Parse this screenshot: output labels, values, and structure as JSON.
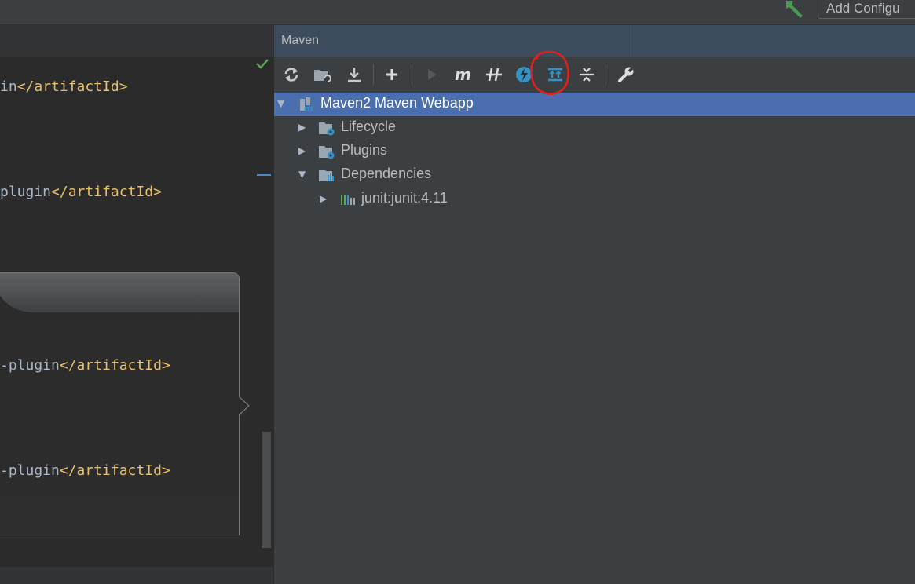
{
  "topbar": {
    "run_config_label": "Add Configu"
  },
  "editor": {
    "lines": [
      {
        "prefix": "in",
        "tag": "</artifactId>"
      },
      {
        "prefix": "plugin",
        "tag": "</artifactId>"
      },
      {
        "prefix": "-plugin",
        "tag": "</artifactId>"
      },
      {
        "prefix": "-plugin",
        "tag": "</artifactId>"
      }
    ]
  },
  "maven": {
    "title": "Maven",
    "toolbar": [
      {
        "name": "reload-icon"
      },
      {
        "name": "generate-sources-icon"
      },
      {
        "name": "download-icon"
      },
      {
        "name": "add-icon"
      },
      {
        "name": "run-icon"
      },
      {
        "name": "execute-goal-icon"
      },
      {
        "name": "toggle-offline-icon"
      },
      {
        "name": "skip-tests-icon"
      },
      {
        "name": "show-dependencies-icon"
      },
      {
        "name": "collapse-all-icon"
      },
      {
        "name": "settings-icon"
      }
    ],
    "tree": [
      {
        "label": "Maven2 Maven Webapp",
        "expanded": true,
        "selected": true
      },
      {
        "label": "Lifecycle",
        "expanded": false
      },
      {
        "label": "Plugins",
        "expanded": false
      },
      {
        "label": "Dependencies",
        "expanded": true
      },
      {
        "label": "junit:junit:4.11",
        "expanded": false
      }
    ]
  },
  "colors": {
    "selection": "#4b6eaf",
    "tag": "#e8bf6a",
    "accent_icon": "#3592c4",
    "annotation": "#e0201a"
  }
}
